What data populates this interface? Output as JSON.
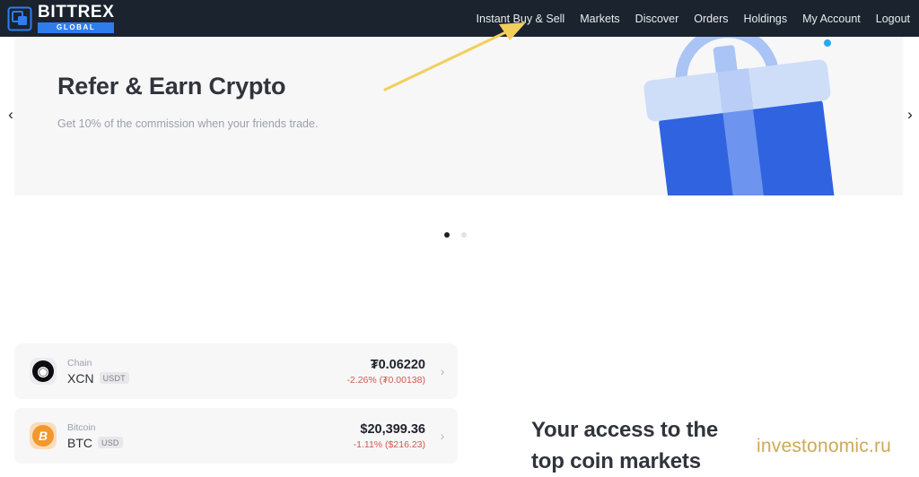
{
  "header": {
    "logo": {
      "word": "BITTREX",
      "sub": "GLOBAL",
      "icon": "bittrex-logo-icon"
    },
    "nav": [
      {
        "label": "Instant Buy & Sell"
      },
      {
        "label": "Markets"
      },
      {
        "label": "Discover"
      },
      {
        "label": "Orders"
      },
      {
        "label": "Holdings"
      },
      {
        "label": "My Account"
      },
      {
        "label": "Logout"
      }
    ],
    "colors": {
      "background": "#1a232e",
      "text": "#e9ecef",
      "accent": "#2f7ded"
    }
  },
  "banner": {
    "title": "Refer & Earn Crypto",
    "subtitle": "Get 10% of the commission when your friends trade.",
    "illustration": "gift-box-illustration",
    "prev_arrow": "‹",
    "next_arrow": "›",
    "dots": [
      {
        "active": true
      },
      {
        "active": false
      }
    ],
    "colors": {
      "card": "#f7f7f8",
      "gift_body": "#2f63e0",
      "gift_lid": "#cedef9"
    }
  },
  "coins": {
    "rows": [
      {
        "icon": "xcn-coin-icon",
        "icon_glyph": "◉",
        "name": "Chain",
        "symbol": "XCN",
        "pair": "USDT",
        "price": "₮0.06220",
        "change": "-2.26% (₮0.00138)",
        "chevron": "›"
      },
      {
        "icon": "btc-coin-icon",
        "icon_glyph": "B",
        "name": "Bitcoin",
        "symbol": "BTC",
        "pair": "USD",
        "price": "$20,399.36",
        "change": "-1.11% ($216.23)",
        "chevron": "›"
      }
    ],
    "change_color": "#d2584c"
  },
  "main": {
    "section_heading_line1": "Your access to the",
    "section_heading_line2": "top coin markets"
  },
  "annotation": {
    "arrow_color": "#f2cf5b",
    "arrow_name": "pointer-arrow-to-instant-buy-sell"
  },
  "watermark": {
    "text": "investonomic.ru",
    "color": "#c9a24a"
  }
}
